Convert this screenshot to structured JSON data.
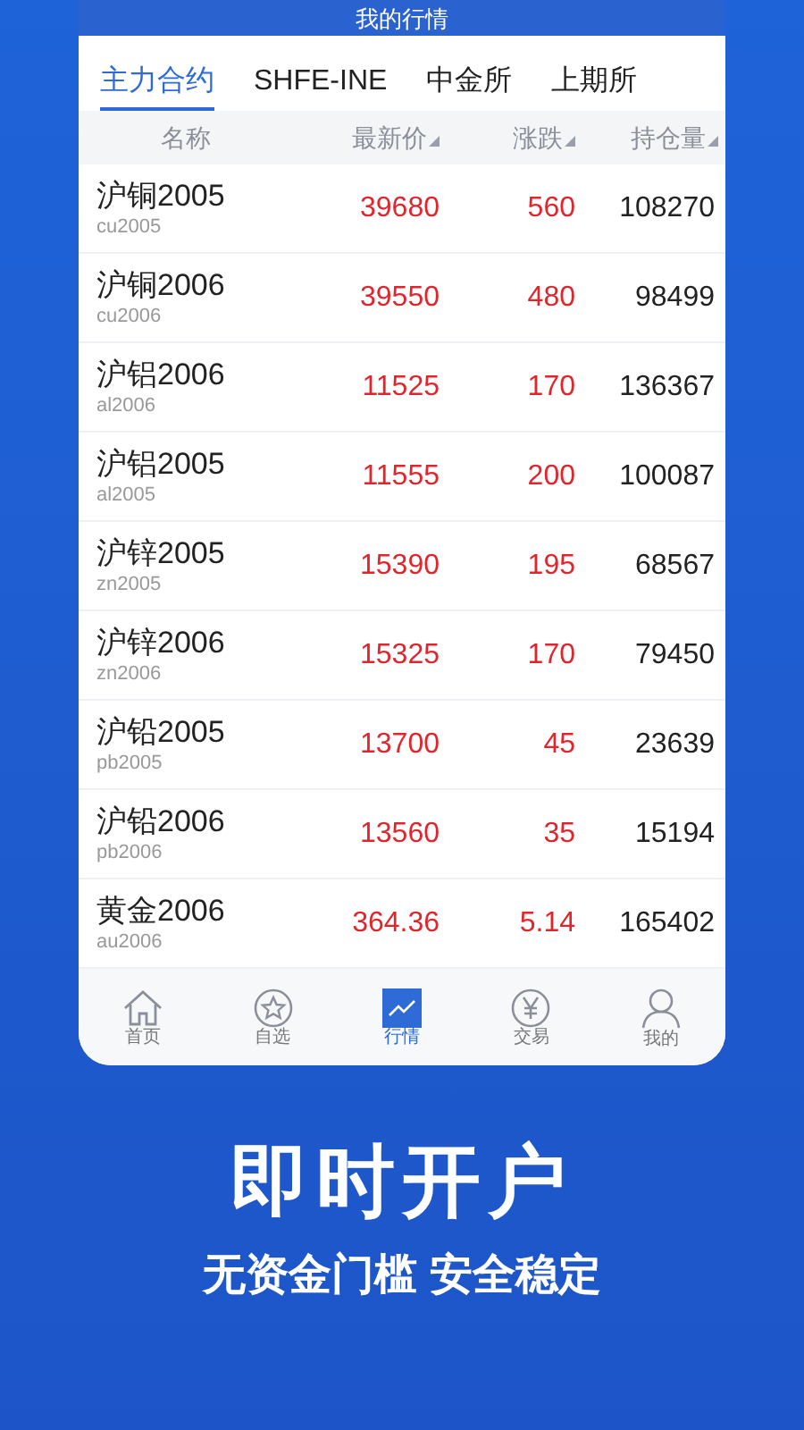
{
  "header": {
    "title": "我的行情"
  },
  "tabs": [
    {
      "label": "主力合约",
      "selected": true
    },
    {
      "label": "SHFE-INE",
      "selected": false
    },
    {
      "label": "中金所",
      "selected": false
    },
    {
      "label": "上期所",
      "selected": false
    }
  ],
  "table": {
    "columns": [
      {
        "label": "名称",
        "sortable": false
      },
      {
        "label": "最新价",
        "sortable": true
      },
      {
        "label": "涨跌",
        "sortable": true
      },
      {
        "label": "持仓量",
        "sortable": true
      }
    ],
    "rows": [
      {
        "name": "沪铜2005",
        "code": "cu2005",
        "price": "39680",
        "change": "560",
        "open_interest": "108270"
      },
      {
        "name": "沪铜2006",
        "code": "cu2006",
        "price": "39550",
        "change": "480",
        "open_interest": "98499"
      },
      {
        "name": "沪铝2006",
        "code": "al2006",
        "price": "11525",
        "change": "170",
        "open_interest": "136367"
      },
      {
        "name": "沪铝2005",
        "code": "al2005",
        "price": "11555",
        "change": "200",
        "open_interest": "100087"
      },
      {
        "name": "沪锌2005",
        "code": "zn2005",
        "price": "15390",
        "change": "195",
        "open_interest": "68567"
      },
      {
        "name": "沪锌2006",
        "code": "zn2006",
        "price": "15325",
        "change": "170",
        "open_interest": "79450"
      },
      {
        "name": "沪铅2005",
        "code": "pb2005",
        "price": "13700",
        "change": "45",
        "open_interest": "23639"
      },
      {
        "name": "沪铅2006",
        "code": "pb2006",
        "price": "13560",
        "change": "35",
        "open_interest": "15194"
      },
      {
        "name": "黄金2006",
        "code": "au2006",
        "price": "364.36",
        "change": "5.14",
        "open_interest": "165402"
      }
    ]
  },
  "bottom_nav": [
    {
      "kind": "home",
      "label": "首页",
      "selected": false
    },
    {
      "kind": "star",
      "label": "自选",
      "selected": false
    },
    {
      "kind": "chart",
      "label": "行情",
      "selected": true
    },
    {
      "kind": "yen",
      "label": "交易",
      "selected": false
    },
    {
      "kind": "person",
      "label": "我的",
      "selected": false
    }
  ],
  "promo": {
    "headline": "即时开户",
    "tagline": "无资金门槛 安全稳定"
  }
}
